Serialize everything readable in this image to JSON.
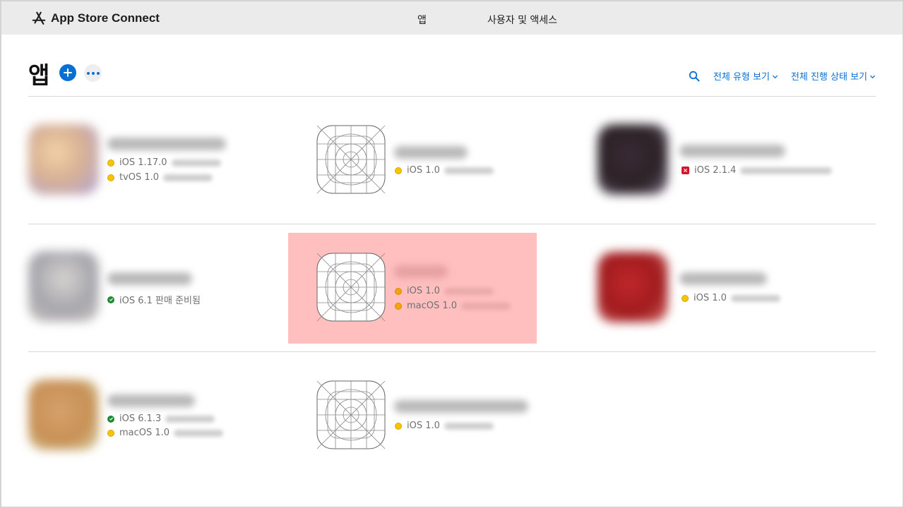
{
  "header": {
    "brand": "App Store Connect",
    "nav": {
      "apps": "앱",
      "users": "사용자 및 액세스"
    }
  },
  "page": {
    "title": "앱",
    "filters": {
      "type": "전체 유형 보기",
      "status": "전체 진행 상태 보기"
    }
  },
  "apps": [
    {
      "statuses": [
        {
          "text": "iOS 1.17.0",
          "color": "yellow"
        },
        {
          "text": "tvOS 1.0",
          "color": "yellow"
        }
      ]
    },
    {
      "statuses": [
        {
          "text": "iOS 1.0",
          "color": "yellow"
        }
      ]
    },
    {
      "statuses": [
        {
          "text": "iOS 2.1.4",
          "color": "red"
        }
      ]
    },
    {
      "statuses": [
        {
          "text": "iOS 6.1 판매 준비됨",
          "color": "green"
        }
      ]
    },
    {
      "statuses": [
        {
          "text": "iOS 1.0",
          "color": "orange"
        },
        {
          "text": "macOS 1.0",
          "color": "orange"
        }
      ]
    },
    {
      "statuses": [
        {
          "text": "iOS 1.0",
          "color": "yellow"
        }
      ]
    },
    {
      "statuses": [
        {
          "text": "iOS 6.1.3",
          "color": "green"
        },
        {
          "text": "macOS 1.0",
          "color": "yellow"
        }
      ]
    },
    {
      "statuses": [
        {
          "text": "iOS 1.0",
          "color": "yellow"
        }
      ]
    }
  ],
  "colors": {
    "accent": "#0a6fd4",
    "highlight": "#ffbfbf",
    "header_bg": "#ebebeb"
  }
}
